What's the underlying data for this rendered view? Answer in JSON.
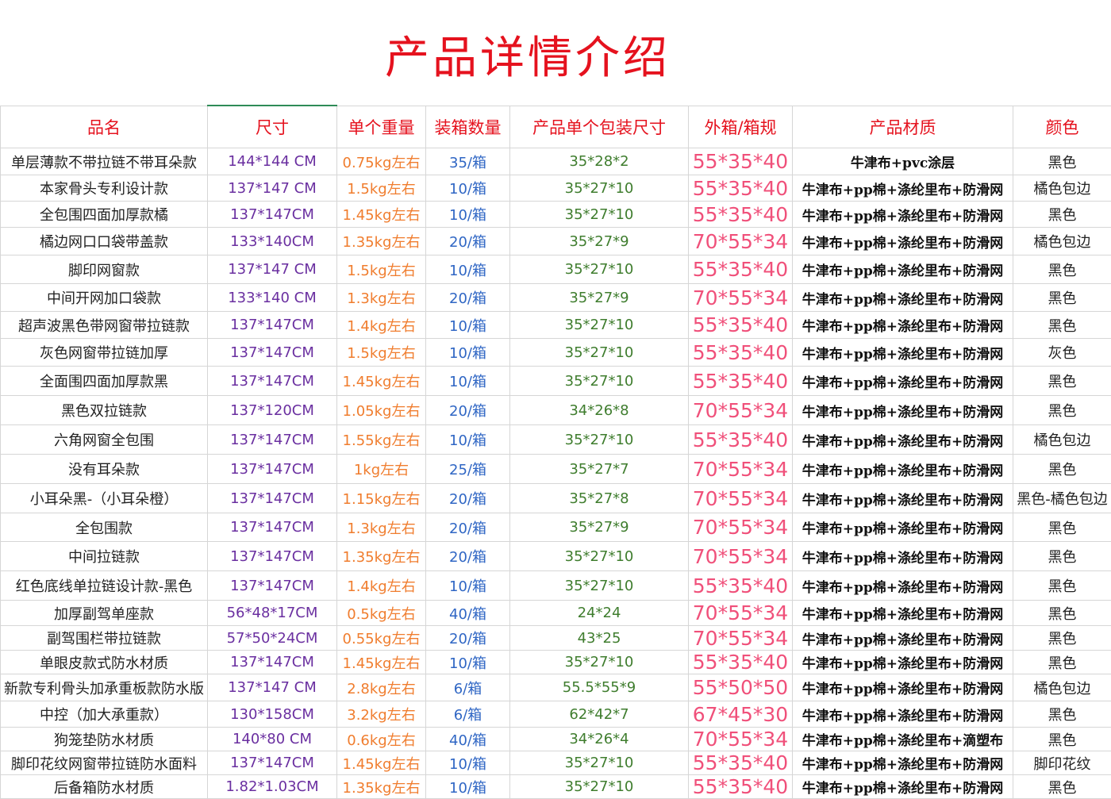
{
  "title": "产品详情介绍",
  "headers": [
    "品名",
    "尺寸",
    "单个重量",
    "装箱数量",
    "产品单个包装尺寸",
    "外箱/箱规",
    "产品材质",
    "颜色"
  ],
  "rows": [
    {
      "name": "单层薄款不带拉链不带耳朵款",
      "size": "144*144 CM",
      "weight": "0.75kg左右",
      "qty": "35/箱",
      "pack": "35*28*2",
      "outer": "55*35*40",
      "material": "牛津布+pvc涂层",
      "color": "黑色"
    },
    {
      "name": "本家骨头专利设计款",
      "size": "137*147 CM",
      "weight": "1.5kg左右",
      "qty": "10/箱",
      "pack": "35*27*10",
      "outer": "55*35*40",
      "material": "牛津布+pp棉+涤纶里布+防滑网",
      "color": "橘色包边"
    },
    {
      "name": "全包围四面加厚款橘",
      "size": "137*147CM",
      "weight": "1.45kg左右",
      "qty": "10/箱",
      "pack": "35*27*10",
      "outer": "55*35*40",
      "material": "牛津布+pp棉+涤纶里布+防滑网",
      "color": "黑色"
    },
    {
      "name": "橘边网口口袋带盖款",
      "size": "133*140CM",
      "weight": "1.35kg左右",
      "qty": "20/箱",
      "pack": "35*27*9",
      "outer": "70*55*34",
      "material": "牛津布+pp棉+涤纶里布+防滑网",
      "color": "橘色包边"
    },
    {
      "name": "脚印网窗款",
      "size": "137*147 CM",
      "weight": "1.5kg左右",
      "qty": "10/箱",
      "pack": "35*27*10",
      "outer": "55*35*40",
      "material": "牛津布+pp棉+涤纶里布+防滑网",
      "color": "黑色"
    },
    {
      "name": "中间开网加口袋款",
      "size": "133*140 CM",
      "weight": "1.3kg左右",
      "qty": "20/箱",
      "pack": "35*27*9",
      "outer": "70*55*34",
      "material": "牛津布+pp棉+涤纶里布+防滑网",
      "color": "黑色"
    },
    {
      "name": "超声波黑色带网窗带拉链款",
      "size": "137*147CM",
      "weight": "1.4kg左右",
      "qty": "10/箱",
      "pack": "35*27*10",
      "outer": "55*35*40",
      "material": "牛津布+pp棉+涤纶里布+防滑网",
      "color": "黑色"
    },
    {
      "name": "灰色网窗带拉链加厚",
      "size": "137*147CM",
      "weight": "1.5kg左右",
      "qty": "10/箱",
      "pack": "35*27*10",
      "outer": "55*35*40",
      "material": "牛津布+pp棉+涤纶里布+防滑网",
      "color": "灰色"
    },
    {
      "name": "全面围四面加厚款黑",
      "size": "137*147CM",
      "weight": "1.45kg左右",
      "qty": "10/箱",
      "pack": "35*27*10",
      "outer": "55*35*40",
      "material": "牛津布+pp棉+涤纶里布+防滑网",
      "color": "黑色"
    },
    {
      "name": "黑色双拉链款",
      "size": "137*120CM",
      "weight": "1.05kg左右",
      "qty": "20/箱",
      "pack": "34*26*8",
      "outer": "70*55*34",
      "material": "牛津布+pp棉+涤纶里布+防滑网",
      "color": "黑色"
    },
    {
      "name": "六角网窗全包围",
      "size": "137*147CM",
      "weight": "1.55kg左右",
      "qty": "10/箱",
      "pack": "35*27*10",
      "outer": "55*35*40",
      "material": "牛津布+pp棉+涤纶里布+防滑网",
      "color": "橘色包边"
    },
    {
      "name": "没有耳朵款",
      "size": "137*147CM",
      "weight": "1kg左右",
      "qty": "25/箱",
      "pack": "35*27*7",
      "outer": "70*55*34",
      "material": "牛津布+pp棉+涤纶里布+防滑网",
      "color": "黑色"
    },
    {
      "name": "小耳朵黑-（小耳朵橙）",
      "size": "137*147CM",
      "weight": "1.15kg左右",
      "qty": "20/箱",
      "pack": "35*27*8",
      "outer": "70*55*34",
      "material": "牛津布+pp棉+涤纶里布+防滑网",
      "color": "黑色-橘色包边"
    },
    {
      "name": "全包围款",
      "size": "137*147CM",
      "weight": "1.3kg左右",
      "qty": "20/箱",
      "pack": "35*27*9",
      "outer": "70*55*34",
      "material": "牛津布+pp棉+涤纶里布+防滑网",
      "color": "黑色"
    },
    {
      "name": "中间拉链款",
      "size": "137*147CM",
      "weight": "1.35kg左右",
      "qty": "20/箱",
      "pack": "35*27*10",
      "outer": "70*55*34",
      "material": "牛津布+pp棉+涤纶里布+防滑网",
      "color": "黑色"
    },
    {
      "name": "红色底线单拉链设计款-黑色",
      "size": "137*147CM",
      "weight": "1.4kg左右",
      "qty": "10/箱",
      "pack": "35*27*10",
      "outer": "55*35*40",
      "material": "牛津布+pp棉+涤纶里布+防滑网",
      "color": "黑色"
    },
    {
      "name": "加厚副驾单座款",
      "size": "56*48*17CM",
      "weight": "0.5kg左右",
      "qty": "40/箱",
      "pack": "24*24",
      "outer": "70*55*34",
      "material": "牛津布+pp棉+涤纶里布+防滑网",
      "color": "黑色"
    },
    {
      "name": "副驾围栏带拉链款",
      "size": "57*50*24CM",
      "weight": "0.55kg左右",
      "qty": "20/箱",
      "pack": "43*25",
      "outer": "70*55*34",
      "material": "牛津布+pp棉+涤纶里布+防滑网",
      "color": "黑色"
    },
    {
      "name": "单眼皮款式防水材质",
      "size": "137*147CM",
      "weight": "1.45kg左右",
      "qty": "10/箱",
      "pack": "35*27*10",
      "outer": "55*35*40",
      "material": "牛津布+pp棉+涤纶里布+防滑网",
      "color": "黑色"
    },
    {
      "name": "新款专利骨头加承重板款防水版",
      "size": "137*147 CM",
      "weight": "2.8kg左右",
      "qty": "6/箱",
      "pack": "55.5*55*9",
      "outer": "55*50*50",
      "material": "牛津布+pp棉+涤纶里布+防滑网",
      "color": "橘色包边"
    },
    {
      "name": "中控（加大承重款）",
      "size": "130*158CM",
      "weight": "3.2kg左右",
      "qty": "6/箱",
      "pack": "62*42*7",
      "outer": "67*45*30",
      "material": "牛津布+pp棉+涤纶里布+防滑网",
      "color": "黑色"
    },
    {
      "name": "狗笼垫防水材质",
      "size": "140*80 CM",
      "weight": "0.6kg左右",
      "qty": "40/箱",
      "pack": "34*26*4",
      "outer": "70*55*34",
      "material": "牛津布+pp棉+涤纶里布+滴塑布",
      "color": "黑色"
    },
    {
      "name": "脚印花纹网窗带拉链防水面料",
      "size": "137*147CM",
      "weight": "1.45kg左右",
      "qty": "10/箱",
      "pack": "35*27*10",
      "outer": "55*35*40",
      "material": "牛津布+pp棉+涤纶里布+防滑网",
      "color": "脚印花纹"
    },
    {
      "name": "后备箱防水材质",
      "size": "1.82*1.03CM",
      "weight": "1.35kg左右",
      "qty": "10/箱",
      "pack": "35*27*10",
      "outer": "55*35*40",
      "material": "牛津布+pp棉+涤纶里布+防滑网",
      "color": "黑色"
    }
  ]
}
